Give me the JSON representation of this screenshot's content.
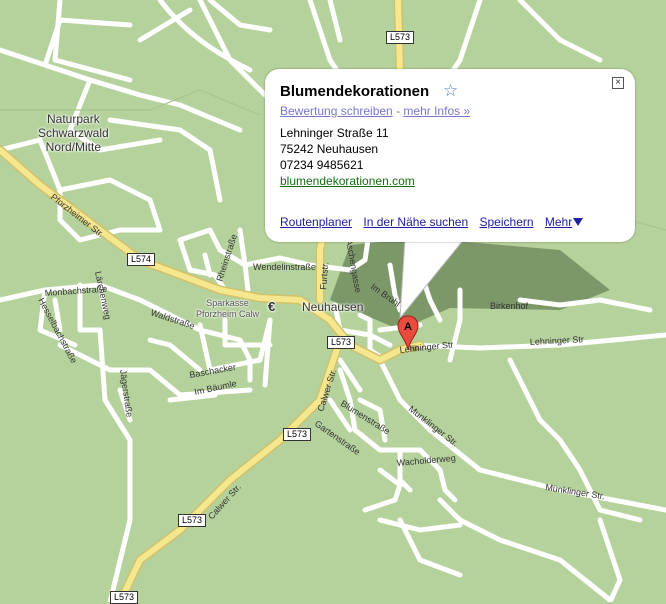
{
  "map": {
    "area_label": "Naturpark\nSchwarzwald\nNord/Mitte",
    "town_label": "Neuhausen",
    "euro_symbol": "€",
    "bank_label": "Sparkasse\nPforzheim Calw",
    "road_shields": [
      "L573",
      "L574",
      "L573",
      "L573",
      "L573",
      "L573"
    ],
    "streets": {
      "pforzheimer": "Pforzheimer Str.",
      "monbach": "Monbachstraße",
      "hessel": "Hesselbachstraße",
      "laerchen": "Lärchenweg",
      "wald": "Waldstraße",
      "jaeger": "Jägerstraße",
      "baschacker": "Baschacker",
      "im_baeumle": "Im Bäumle",
      "rhein": "Rheinstraße",
      "wendelin": "Wendelinstraße",
      "furtstr": "Furtstr.",
      "aschengasse": "Aschengasse",
      "im_bruehl": "Im Brühl",
      "birkenhof": "Birkenhof",
      "lehninger1": "Lehninger Str",
      "lehninger2": "Lehninger Str",
      "calwer1": "Calwer Str.",
      "calwer2": "Calwer Str.",
      "blumen": "Blumenstraße",
      "garten": "Gartenstraße",
      "munklinger1": "Munklinger Str.",
      "munklinger2": "Münklinger Str.",
      "wacholder": "Wacholderweg",
      "weg_short": "weg"
    },
    "colors": {
      "land": "#b5d29c",
      "road": "#ffffff",
      "highway": "#f5e78e"
    }
  },
  "marker": {
    "letter": "A"
  },
  "infowindow": {
    "title": "Blumendekorationen",
    "rate_link": "Bewertung schreiben",
    "separator": "-",
    "more_link": "mehr Infos »",
    "street": "Lehninger Straße 11",
    "city": "75242 Neuhausen",
    "phone": "07234 9485621",
    "website": "blumendekorationen.com",
    "actions": [
      "Routenplaner",
      "In der Nähe suchen",
      "Speichern",
      "Mehr"
    ],
    "close_symbol": "×",
    "star_symbol": "☆"
  }
}
